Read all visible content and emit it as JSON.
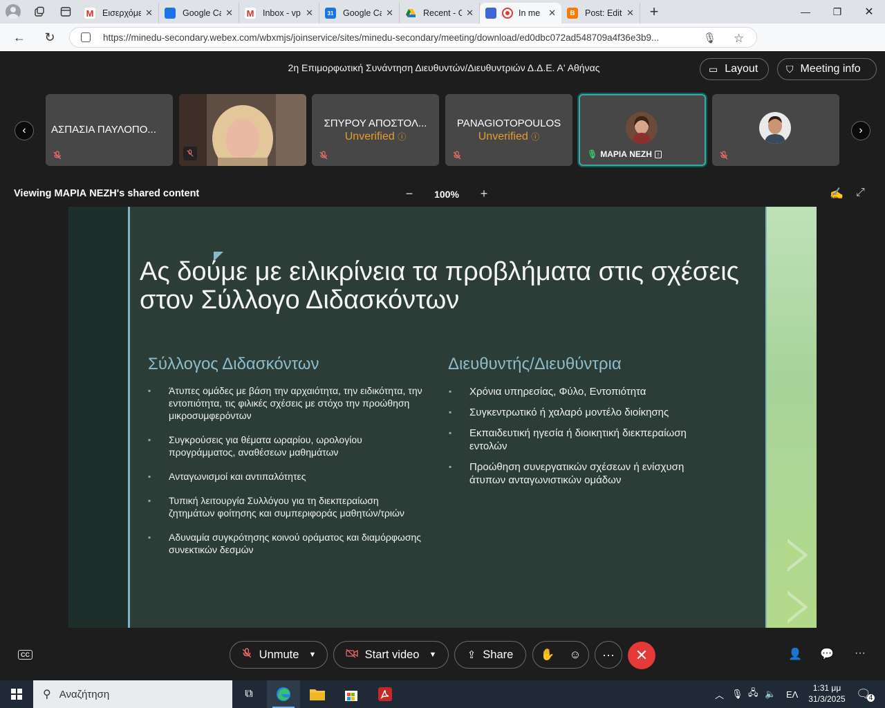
{
  "browser": {
    "tabs": [
      {
        "label": "Εισερχόμε",
        "favicon": "gmail-icon",
        "color": "#d93025"
      },
      {
        "label": "Google Ca",
        "favicon": "google-calendar-icon",
        "color": "#1a73e8"
      },
      {
        "label": "Inbox - vp",
        "favicon": "gmail-icon",
        "color": "#d93025"
      },
      {
        "label": "Google Ca",
        "favicon": "google-calendar-icon",
        "color": "#1a73e8"
      },
      {
        "label": "Recent - G",
        "favicon": "google-drive-icon",
        "color": "#188038"
      },
      {
        "label": "In me",
        "favicon": "webex-icon",
        "color": "#e53935"
      },
      {
        "label": "Post: Edit",
        "favicon": "blogger-icon",
        "color": "#f57c00"
      }
    ],
    "url": "https://minedu-secondary.webex.com/wbxmjs/joinservice/sites/minedu-secondary/meeting/download/ed0dbc072ad548709a4f36e3b9..."
  },
  "meeting": {
    "title": "2η Επιμορφωτική Συνάντηση Διευθυντών/Διευθυντριών Δ.Δ.Ε. Α' Αθήνας",
    "layout_label": "Layout",
    "info_label": "Meeting info",
    "participants": [
      {
        "name": "ΑΣΠΑΣΙΑ ΠΑΥΛΟΠΟ...",
        "status": ""
      },
      {
        "name": "",
        "status": ""
      },
      {
        "name": "ΣΠΥΡΟΥ ΑΠΟΣΤΟΛ...",
        "status": "Unverified"
      },
      {
        "name": "PANAGIOTOPOULOS",
        "status": "Unverified"
      },
      {
        "name": "ΜΑΡΙΑ ΝΕΖΗ",
        "status": ""
      },
      {
        "name": "",
        "status": ""
      }
    ],
    "sharing_label": "Viewing ΜΑΡΙΑ ΝΕΖΗ's shared content",
    "zoom_level": "100%"
  },
  "slide": {
    "title": "Ας δούμε με ειλικρίνεια τα προβλήματα στις σχέσεις  στον Σύλλογο Διδασκόντων",
    "left_heading": "Σύλλογος Διδασκόντων",
    "left_bullets": [
      "Άτυπες ομάδες  με βάση την αρχαιότητα, την ειδικότητα, την εντοπιότητα, τις φιλικές σχέσεις με στόχο την προώθηση μικροσυμφερόντων",
      "Συγκρούσεις για θέματα ωραρίου, ωρολογίου προγράμματος, αναθέσεων μαθημάτων",
      "Ανταγωνισμοί και αντιπαλότητες",
      "Τυπική λειτουργία Συλλόγου για τη διεκπεραίωση ζητημάτων φοίτησης και συμπεριφοράς μαθητών/τριών",
      "Αδυναμία συγκρότησης κοινού οράματος και διαμόρφωσης συνεκτικών δεσμών"
    ],
    "right_heading": "Διευθυντής/Διευθύντρια",
    "right_bullets": [
      "Χρόνια υπηρεσίας, Φύλο, Εντοπιότητα",
      "Συγκεντρωτικό ή χαλαρό μοντέλο διοίκησης",
      "Εκπαιδευτική ηγεσία ή διοικητική διεκπεραίωση εντολών",
      "Προώθηση συνεργατικών σχέσεων ή ενίσχυση άτυπων ανταγωνιστικών ομάδων"
    ]
  },
  "controls": {
    "unmute": "Unmute",
    "start_video": "Start video",
    "share": "Share"
  },
  "taskbar": {
    "search_placeholder": "Αναζήτηση",
    "language": "ΕΛ",
    "time": "1:31 μμ",
    "date": "31/3/2025",
    "notifications": "4"
  },
  "colors": {
    "accent_teal": "#3ea7a0",
    "unverified": "#e99a2c",
    "end_call": "#e53935",
    "slide_bg": "#2c3d37"
  }
}
